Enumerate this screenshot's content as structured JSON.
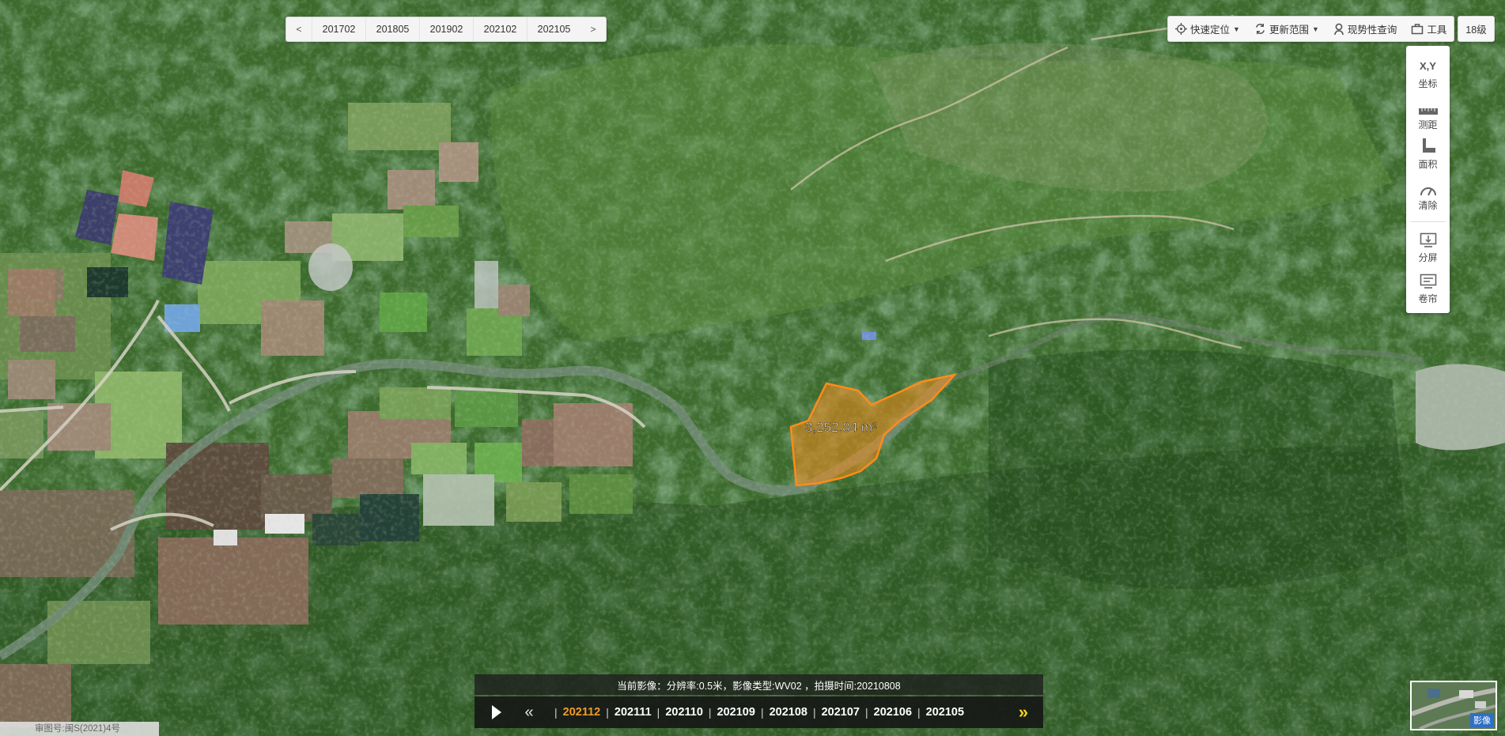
{
  "year_selector": {
    "prev": "<",
    "next": ">",
    "years": [
      "201702",
      "201805",
      "201902",
      "202102",
      "202105"
    ]
  },
  "toolbar": {
    "locate_label": "快速定位",
    "refresh_label": "更新范围",
    "status_query_label": "现势性查询",
    "tools_label": "工具"
  },
  "zoom_level": "18级",
  "side_tools": {
    "coord_icon_text": "X,Y",
    "coord_label": "坐标",
    "distance_label": "测距",
    "area_label": "面积",
    "clear_label": "清除",
    "split_label": "分屏",
    "swipe_label": "卷帘"
  },
  "measurement": {
    "area_text": "3,252.84 m²",
    "fill_color": "#f28a1e"
  },
  "imagery_info": "当前影像：分辨率:0.5米，影像类型:WV02 ，拍摄时间:20210808",
  "timeline": {
    "dates": [
      "202112",
      "202111",
      "202110",
      "202109",
      "202108",
      "202107",
      "202106",
      "202105"
    ],
    "active_index": 0,
    "active_color": "#f39c24",
    "arrow_color": "#f5d21a"
  },
  "credit": "审图号:闽S(2021)4号",
  "minimap_label": "影像"
}
